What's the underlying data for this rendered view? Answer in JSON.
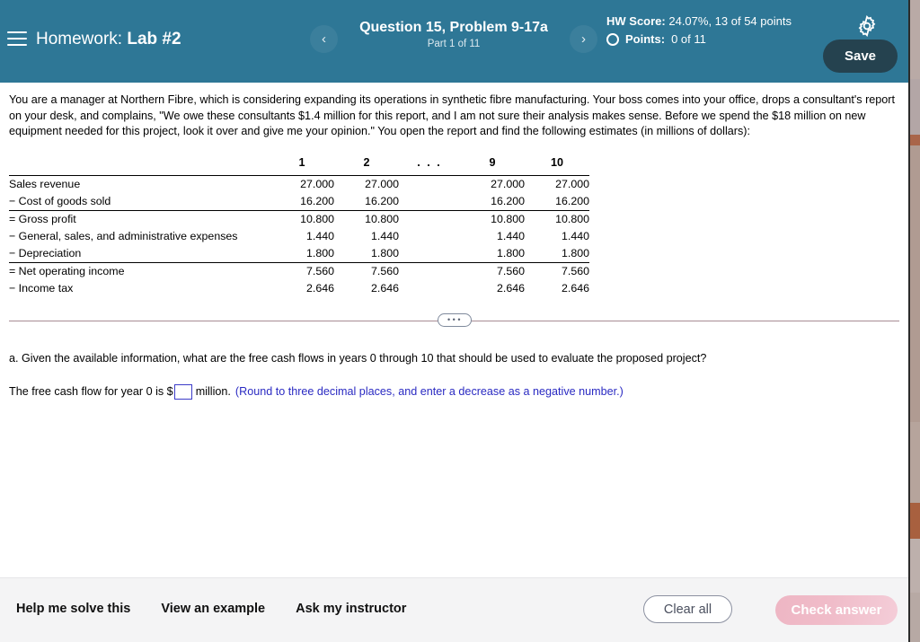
{
  "header": {
    "menu_icon": "hamburger-icon",
    "assignment_prefix": "Homework:",
    "assignment_name": "Lab #2",
    "prev_label": "‹",
    "next_label": "›",
    "question_title": "Question 15, Problem 9-17a",
    "question_part": "Part 1 of 11",
    "hw_score_label": "HW Score:",
    "hw_score_value": "24.07%, 13 of 54 points",
    "points_label": "Points:",
    "points_value": "0 of 11",
    "gear_icon": "gear-icon",
    "save_label": "Save",
    "bg_color": "#2e7796",
    "save_bg_color": "#25424f"
  },
  "body": {
    "problem_text": "You are a manager at Northern Fibre, which is considering expanding its operations in synthetic fibre manufacturing. Your boss comes into your office, drops a consultant's report on your desk, and complains, \"We owe these consultants $1.4 million for this report, and I am not sure their analysis makes sense. Before we spend the $18 million on new equipment needed for this project, look it over and give me your opinion.\" You open the report and find the following estimates (in millions of dollars):",
    "expand_button_label": "•••",
    "question_a": "a. Given the available information, what are the free cash flows in years 0 through 10 that should be used to evaluate the proposed project?",
    "answer_prefix": "The free cash flow for year 0 is $",
    "answer_value": "",
    "answer_suffix": "million.",
    "answer_hint": "(Round to three decimal places, and enter a decrease as a negative number.)",
    "hint_color": "#2a2ac2"
  },
  "table": {
    "columns": [
      "1",
      "2",
      ". . .",
      "9",
      "10"
    ],
    "rows": [
      {
        "label": "Sales revenue",
        "values": [
          "27.000",
          "27.000",
          "",
          "27.000",
          "27.000"
        ],
        "rule_above": true
      },
      {
        "label": "− Cost of goods sold",
        "values": [
          "16.200",
          "16.200",
          "",
          "16.200",
          "16.200"
        ],
        "rule_above": false
      },
      {
        "label": "= Gross profit",
        "values": [
          "10.800",
          "10.800",
          "",
          "10.800",
          "10.800"
        ],
        "rule_above": true
      },
      {
        "label": "− General, sales, and administrative expenses",
        "values": [
          "1.440",
          "1.440",
          "",
          "1.440",
          "1.440"
        ],
        "rule_above": false
      },
      {
        "label": "− Depreciation",
        "values": [
          "1.800",
          "1.800",
          "",
          "1.800",
          "1.800"
        ],
        "rule_above": false
      },
      {
        "label": "= Net operating income",
        "values": [
          "7.560",
          "7.560",
          "",
          "7.560",
          "7.560"
        ],
        "rule_above": true
      },
      {
        "label": "− Income tax",
        "values": [
          "2.646",
          "2.646",
          "",
          "2.646",
          "2.646"
        ],
        "rule_above": false
      }
    ]
  },
  "footer": {
    "links": [
      {
        "label": "Help me solve this"
      },
      {
        "label": "View an example"
      },
      {
        "label": "Ask my instructor"
      }
    ],
    "clear_all_label": "Clear all",
    "check_answer_label": "Check answer",
    "check_answer_color": "#efbac7"
  }
}
